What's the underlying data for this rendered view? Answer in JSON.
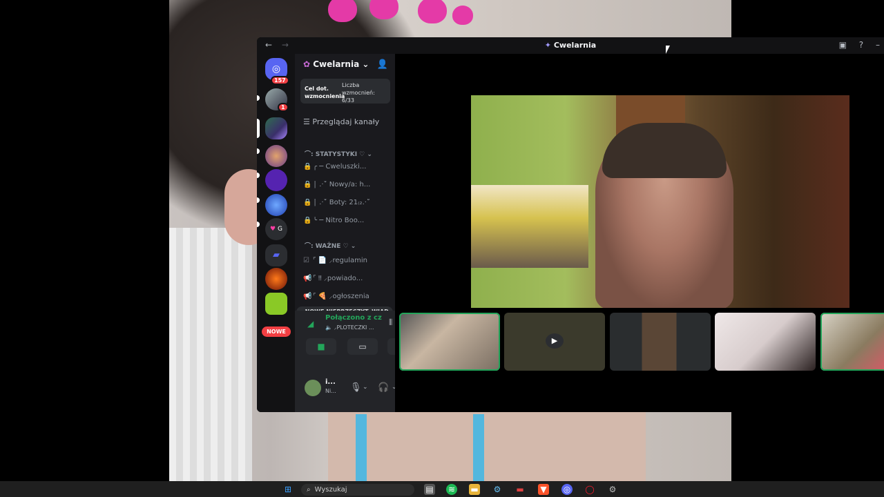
{
  "window": {
    "title": "Cwelarnia",
    "nav_back": "←",
    "nav_forward": "→",
    "inbox_icon": "inbox-icon",
    "help_icon": "?",
    "minimize": "–"
  },
  "server_list": {
    "home_badge": "157",
    "server2_badge": "1",
    "folder_label": "G",
    "nowe_badge": "NOWE"
  },
  "sidebar": {
    "guild_name": "Cwelarnia",
    "boost_goal": "Cel dot. wzmocnienia",
    "boost_count_label": "Liczba wzmocnień:",
    "boost_count": "6/33",
    "browse_channels": "Przeglądaj kanały",
    "categories": [
      {
        "name": "⌒: STATYSTYKI ♡",
        "channels": [
          {
            "icon": "lock-icon",
            "name": "╭ ─ Cweluszki..."
          },
          {
            "icon": "lock-icon",
            "name": "│ .·˚ Nowy/a: h..."
          },
          {
            "icon": "lock-icon",
            "name": "│ .·˚ Boty: 21₍₂.·˚"
          },
          {
            "icon": "lock-icon",
            "name": "╰ ─ Nitro Boo..."
          }
        ]
      },
      {
        "name": "⌒: WAŻNE ♡",
        "channels": [
          {
            "icon": "rules-icon",
            "name": "⌜ 📄 ⸝regulamin"
          },
          {
            "icon": "announcement-icon",
            "name": "⌜ ‼ ⸝powiado..."
          },
          {
            "icon": "announcement-icon",
            "name": "⌜ 🍕 ⸝ogłoszenia"
          }
        ]
      }
    ],
    "new_unread": "NOWE NIEPRZECZYT. WIAD."
  },
  "voice": {
    "status": "Połączono z czatem",
    "channel": "⸝PLOTECZKI ..."
  },
  "user": {
    "name": "i...",
    "status": "Ni..."
  },
  "taskbar": {
    "search_placeholder": "Wyszukaj"
  }
}
